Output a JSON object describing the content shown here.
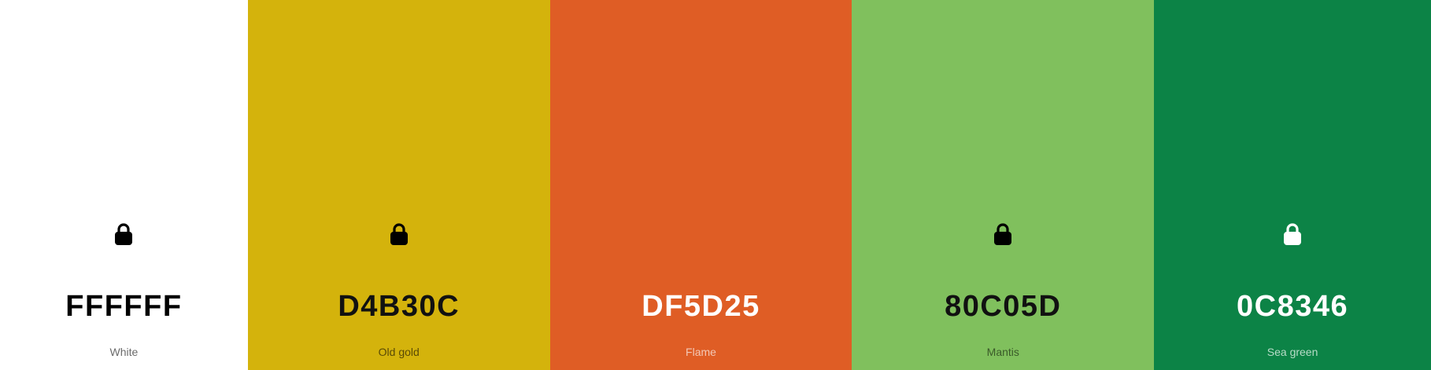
{
  "palette": {
    "swatches": [
      {
        "hex": "FFFFFF",
        "name": "White",
        "color": "#FFFFFF",
        "text_color": "#000000",
        "name_color": "#6b6b6b",
        "lock_color": "#000000",
        "locked": true
      },
      {
        "hex": "D4B30C",
        "name": "Old gold",
        "color": "#D4B30C",
        "text_color": "#111111",
        "name_color": "#5a4b06",
        "lock_color": "#000000",
        "locked": true
      },
      {
        "hex": "DF5D25",
        "name": "Flame",
        "color": "#DF5D25",
        "text_color": "#FFFFFF",
        "name_color": "#f3c8b6",
        "lock_color": null,
        "locked": false
      },
      {
        "hex": "80C05D",
        "name": "Mantis",
        "color": "#80C05D",
        "text_color": "#111111",
        "name_color": "#3a5a29",
        "lock_color": "#000000",
        "locked": true
      },
      {
        "hex": "0C8346",
        "name": "Sea green",
        "color": "#0C8346",
        "text_color": "#FFFFFF",
        "name_color": "#b8dcc8",
        "lock_color": "#FFFFFF",
        "locked": true
      }
    ]
  }
}
